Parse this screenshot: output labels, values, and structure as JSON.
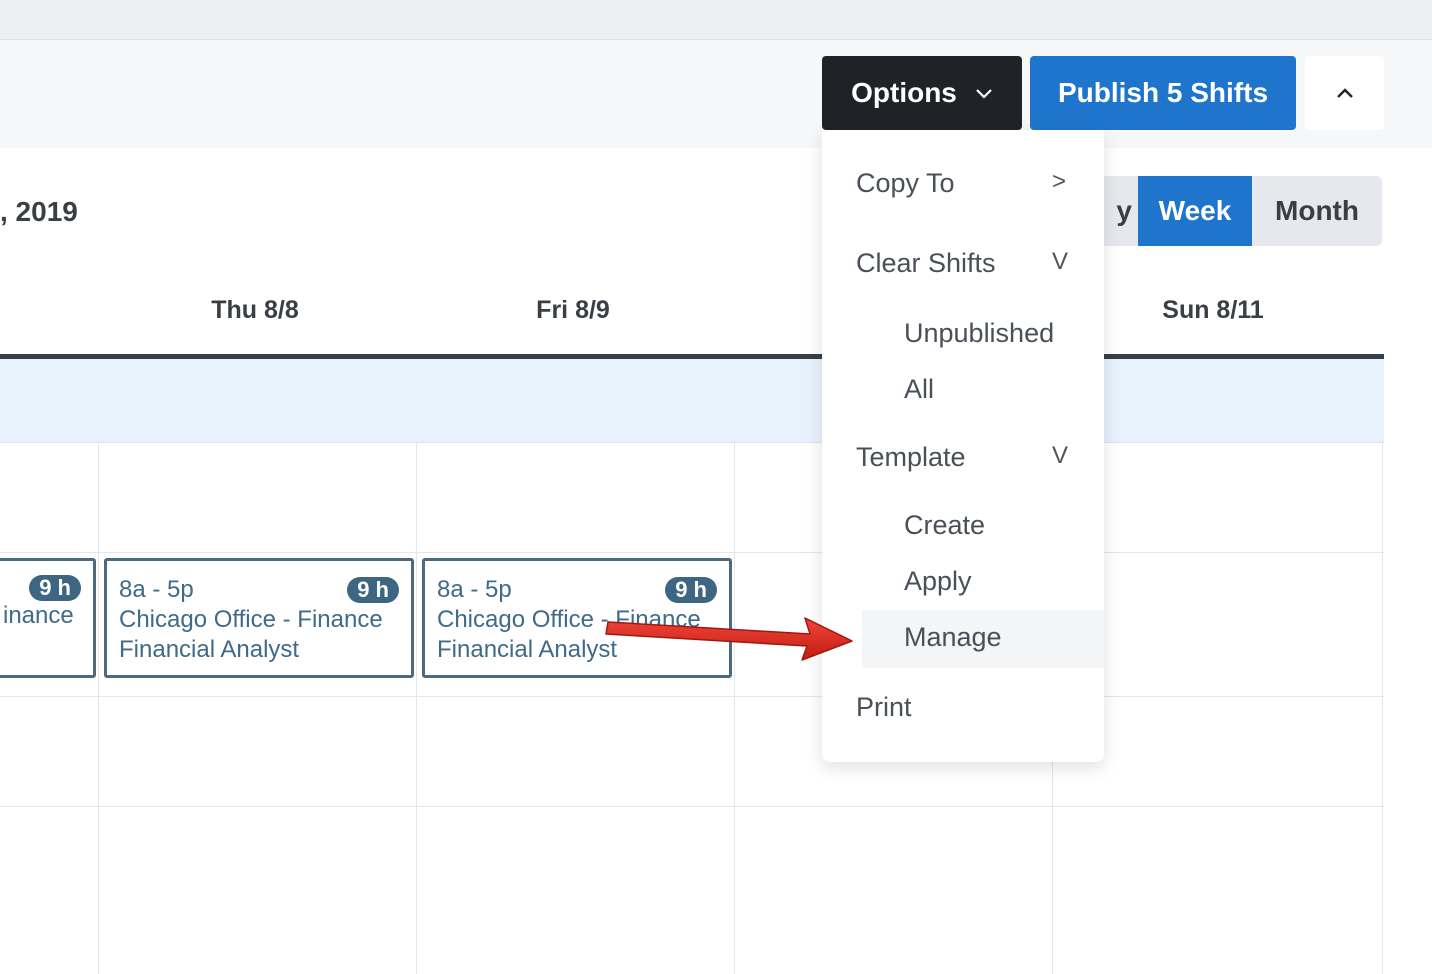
{
  "toolbar": {
    "options_label": "Options",
    "publish_label": "Publish 5 Shifts"
  },
  "schedule": {
    "date_range": ", 2019",
    "views": {
      "day_partial": "y",
      "week": "Week",
      "month": "Month"
    },
    "days": [
      "Thu 8/8",
      "Fri 8/9",
      "Sun 8/11"
    ]
  },
  "shifts": [
    {
      "time": "",
      "hours": "9 h",
      "location": "inance",
      "role": ""
    },
    {
      "time": "8a - 5p",
      "hours": "9 h",
      "location": "Chicago Office - Finance",
      "role": "Financial Analyst"
    },
    {
      "time": "8a - 5p",
      "hours": "9 h",
      "location": "Chicago Office - Finance",
      "role": "Financial Analyst"
    }
  ],
  "menu": {
    "copy_to": "Copy To",
    "copy_to_caret": ">",
    "clear_shifts": "Clear Shifts",
    "clear_caret": "V",
    "unpublished": "Unpublished",
    "all": "All",
    "template": "Template",
    "template_caret": "V",
    "create": "Create",
    "apply": "Apply",
    "manage": "Manage",
    "print": "Print"
  },
  "colors": {
    "options_bg": "#1f2328",
    "primary": "#1f75cb",
    "shift_border": "#4b6a80",
    "annotation_arrow": "#d93025"
  }
}
